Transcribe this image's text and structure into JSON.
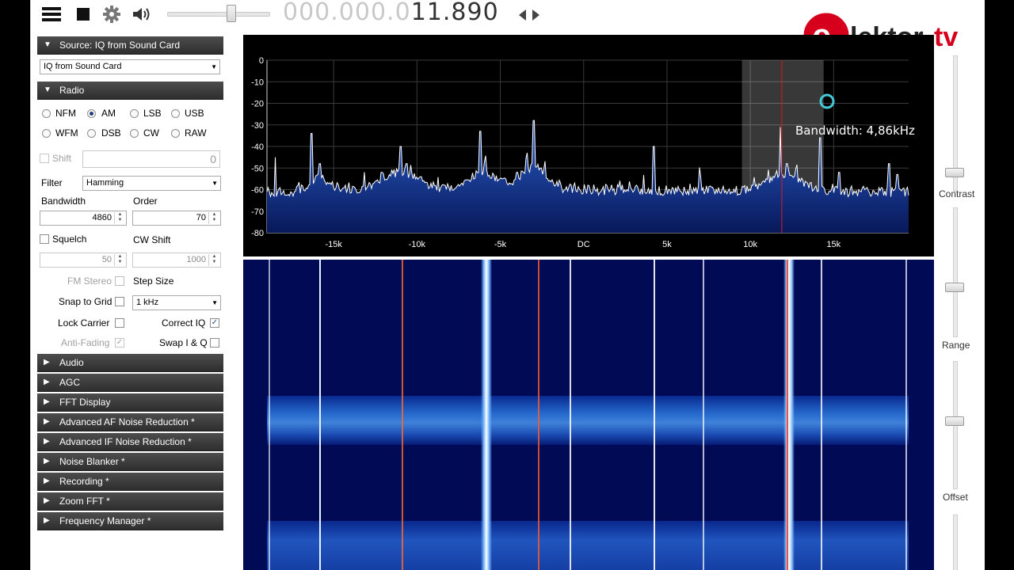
{
  "toolbar": {
    "menu_icon": "hamburger-menu-icon",
    "stop_icon": "stop-icon",
    "settings_icon": "gear-icon",
    "audio_icon": "speaker-icon",
    "frequency_dim": "000.000.0",
    "frequency_main": "11.890",
    "tune_icon": "left-right-arrows-icon",
    "volume_level": 0.68
  },
  "source": {
    "header": "Source: IQ from Sound Card",
    "selected": "IQ from Sound Card"
  },
  "radio": {
    "header": "Radio",
    "modes": [
      "NFM",
      "AM",
      "LSB",
      "USB",
      "WFM",
      "DSB",
      "CW",
      "RAW"
    ],
    "selected_mode": "AM",
    "shift_label": "Shift",
    "shift_value": "0",
    "filter_label": "Filter",
    "filter_value": "Hamming",
    "bandwidth_label": "Bandwidth",
    "bandwidth_value": "4860",
    "order_label": "Order",
    "order_value": "70",
    "squelch_label": "Squelch",
    "squelch_value": "50",
    "cw_shift_label": "CW Shift",
    "cw_shift_value": "1000",
    "fm_stereo_label": "FM Stereo",
    "step_size_label": "Step Size",
    "snap_label": "Snap to Grid",
    "step_value": "1 kHz",
    "lock_carrier_label": "Lock Carrier",
    "correct_iq_label": "Correct IQ",
    "anti_fading_label": "Anti-Fading",
    "swap_iq_label": "Swap I & Q"
  },
  "sections": [
    "Audio",
    "AGC",
    "FFT Display",
    "Advanced AF Noise Reduction *",
    "Advanced IF Noise Reduction *",
    "Noise Blanker *",
    "Recording *",
    "Zoom FFT *",
    "Frequency Manager *"
  ],
  "spectrum": {
    "y_ticks": [
      "0",
      "-10",
      "-20",
      "-30",
      "-40",
      "-50",
      "-60",
      "-70",
      "-80"
    ],
    "x_ticks": [
      "-15k",
      "-10k",
      "-5k",
      "DC",
      "5k",
      "10k",
      "15k"
    ],
    "bandwidth_label": "Bandwidth: 4,86kHz",
    "filter_window": [
      9.5,
      14.4
    ],
    "tuned_offset": 11.89
  },
  "right_panel": {
    "contrast_label": "Contrast",
    "range_label": "Range",
    "offset_label": "Offset"
  },
  "logo_text": "elektortv"
}
